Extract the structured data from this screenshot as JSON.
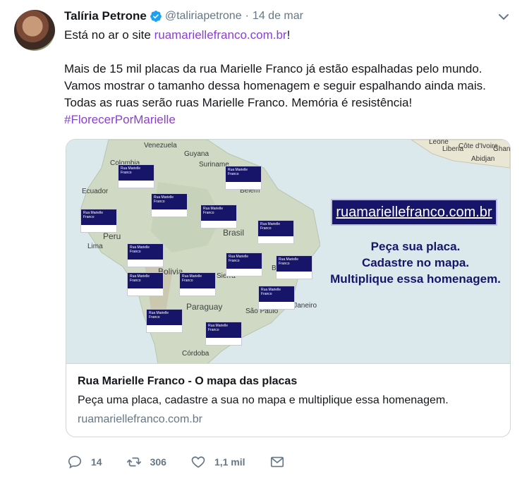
{
  "tweet": {
    "author_name": "Talíria Petrone",
    "handle": "@taliriapetrone",
    "separator": "·",
    "date": "14 de mar",
    "line1_prefix": "Está no ar o site ",
    "line1_link": "ruamariellefranco.com.br",
    "line1_suffix": "!",
    "para2_line1": "Mais de 15 mil placas da rua Marielle Franco já estão espalhadas pelo mundo.",
    "para2_line2": "Vamos mostrar o tamanho dessa homenagem e seguir espalhando ainda mais.",
    "para2_line3": "Todas as ruas serão ruas Marielle Franco. Memória é resistência!",
    "hashtag": "#FlorecerPorMarielle"
  },
  "card": {
    "title": "Rua Marielle Franco - O mapa das placas",
    "description": "Peça uma placa, cadastre a sua no mapa e multiplique essa homenagem.",
    "domain": "ruamariellefranco.com.br",
    "image": {
      "url_text": "ruamariellefranco.com.br",
      "promo_line1": "Peça sua placa.",
      "promo_line2": "Cadastre no mapa.",
      "promo_line3": "Multiplique essa homenagem.",
      "placa_text": "Rua Marielle Franco",
      "map_labels": {
        "venezuela": "Venezuela",
        "colombia": "Colombia",
        "guyana": "Guyana",
        "suriname": "Suriname",
        "belem": "Belém",
        "ecuador": "Ecuador",
        "peru": "Peru",
        "brasil": "Brasil",
        "lima": "Lima",
        "bolivia": "Bolivia",
        "brasilia": "Brasília",
        "sierra": "Sierra",
        "paraguay": "Paraguay",
        "rio": "o de Janeiro",
        "saopaulo": "São Paulo",
        "cordoba": "Córdoba",
        "liberia": "Liberia",
        "cote": "Côte d'Ivoire",
        "ghana": "Ghana",
        "abidjan": "Abidjan",
        "leone": "Leone"
      }
    }
  },
  "actions": {
    "replies": "14",
    "retweets": "306",
    "likes": "1,1 mil"
  },
  "colors": {
    "link": "#8b3fd1",
    "verified": "#1da1f2",
    "navy": "#17156a"
  }
}
